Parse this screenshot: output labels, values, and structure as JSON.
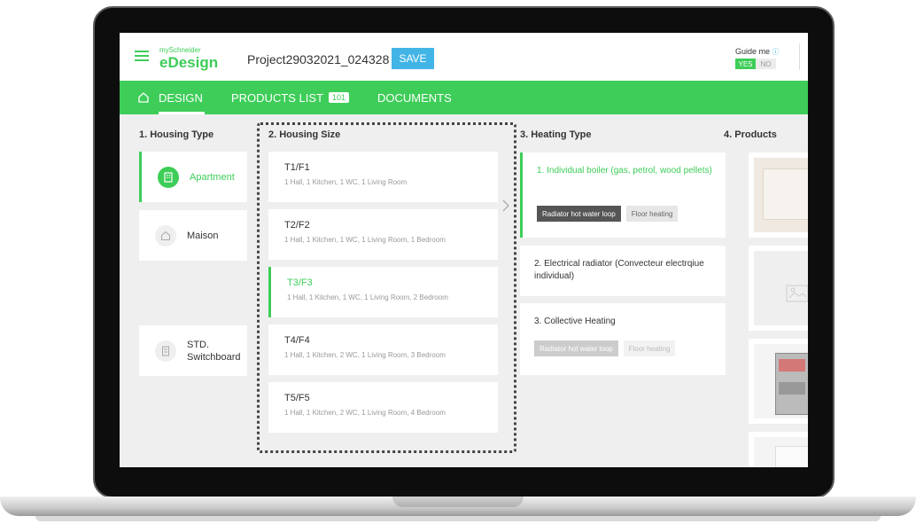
{
  "app": {
    "brand_small": "mySchneider",
    "brand_name": "eDesign",
    "project_name": "Project29032021_024328",
    "save_label": "SAVE",
    "guide_label": "Guide me",
    "guide_info_icon": "info-icon",
    "guide_yes": "YES",
    "guide_no": "NO",
    "guide_selected": "YES"
  },
  "nav": {
    "design": "DESIGN",
    "products_list": "PRODUCTS LIST",
    "products_count": "101",
    "documents": "DOCUMENTS"
  },
  "housing_type": {
    "title": "1. Housing Type",
    "items": [
      {
        "label": "Apartment",
        "icon": "building-icon",
        "selected": true
      },
      {
        "label": "Maison",
        "icon": "house-icon",
        "selected": false
      },
      {
        "label": "STD. Switchboard",
        "icon": "switchboard-icon",
        "selected": false
      }
    ]
  },
  "housing_size": {
    "title": "2. Housing Size",
    "items": [
      {
        "title": "T1/F1",
        "desc": "1 Hall, 1 Kitchen, 1 WC, 1 Living Room",
        "selected": false
      },
      {
        "title": "T2/F2",
        "desc": "1 Hall, 1 Kitchen, 1 WC, 1 Living Room, 1 Bedroom",
        "selected": false
      },
      {
        "title": "T3/F3",
        "desc": "1 Hall, 1 Kitchen, 1 WC, 1 Living Room, 2 Bedroom",
        "selected": true
      },
      {
        "title": "T4/F4",
        "desc": "1 Hall, 1 Kitchen, 2 WC, 1 Living Room, 3 Bedroom",
        "selected": false
      },
      {
        "title": "T5/F5",
        "desc": "1 Hall, 1 Kitchen, 2 WC, 1 Living Room, 4 Bedroom",
        "selected": false
      }
    ]
  },
  "heating_type": {
    "title": "3. Heating Type",
    "items": [
      {
        "title": "1. Individual boiler (gas, petrol, wood pellets)",
        "selected": true,
        "chips": [
          "Radiator hot water loop",
          "Floor heating"
        ]
      },
      {
        "title": "2. Electrical radiator (Convecteur electrqiue individual)",
        "selected": false,
        "chips": []
      },
      {
        "title": "3. Collective Heating",
        "selected": false,
        "chips": [
          "Radiator hot water loop",
          "Floor heating"
        ]
      }
    ]
  },
  "products": {
    "title": "4. Products"
  },
  "colors": {
    "brand_green": "#3dcd58",
    "save_blue": "#42b4e6"
  }
}
